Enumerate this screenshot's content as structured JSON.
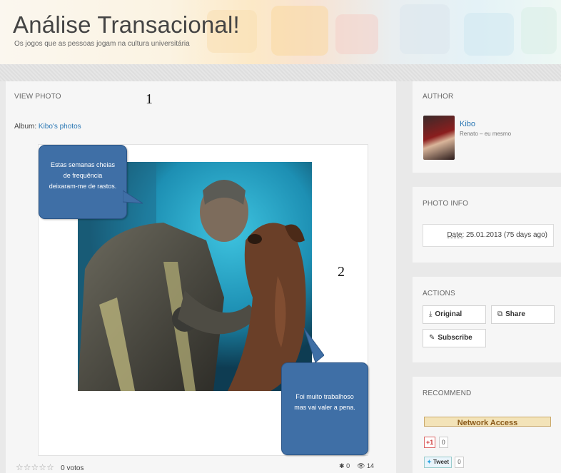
{
  "header": {
    "title": "Análise Transacional!",
    "subtitle": "Os jogos que as pessoas jogam na cultura universitária"
  },
  "main": {
    "section_label": "VIEW PHOTO",
    "marker_1": "1",
    "marker_2": "2",
    "album_prefix": "Album:",
    "album_link": "Kibo's photos",
    "bubble_top": [
      "Estas semanas cheias",
      "de frequência",
      "deixaram-me de rastos."
    ],
    "bubble_bottom": [
      "Foi muito trabalhoso",
      "mas vai valer a pena."
    ],
    "rating": {
      "stars": 0,
      "max_stars": 5,
      "votes_label": "0 votos"
    },
    "favorites_count": "0",
    "views_count": "14"
  },
  "author": {
    "label": "AUTHOR",
    "name": "Kibo",
    "description": "Renato – eu mesmo"
  },
  "photo_info": {
    "label": "PHOTO INFO",
    "date_label": "Date:",
    "date_value": "25.01.2013 (75 days ago)"
  },
  "actions": {
    "label": "ACTIONS",
    "original": "Original",
    "share": "Share",
    "subscribe": "Subscribe"
  },
  "recommend": {
    "label": "RECOMMEND",
    "banner": "Network Access",
    "gplus_label": "+1",
    "gplus_count": "0",
    "tweet_label": "Tweet",
    "tweet_count": "0"
  },
  "icons": {
    "download": "download-icon",
    "share": "share-icon",
    "subscribe": "tag-icon",
    "star": "star-icon",
    "eye": "eye-icon"
  },
  "colors": {
    "link": "#2a77b4",
    "bubble": "#3f6fa6",
    "banner": "#f3e3b8"
  }
}
